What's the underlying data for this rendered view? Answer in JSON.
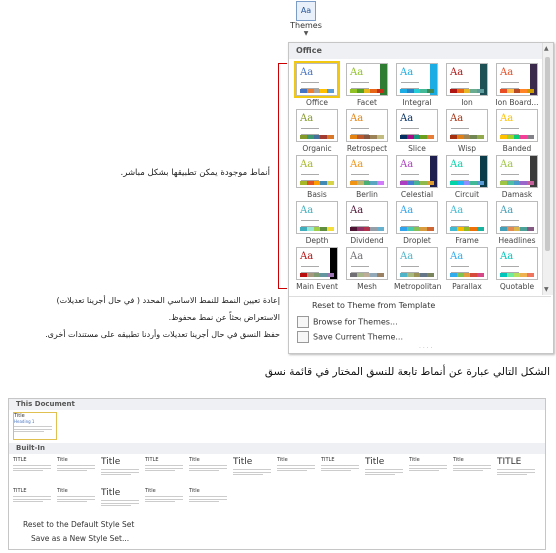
{
  "themes_button": {
    "label": "Themes",
    "icon": "Aa"
  },
  "gallery": {
    "section": "Office",
    "tiles": [
      {
        "label": "Office",
        "bars": [
          "#4472c4",
          "#ed7d31",
          "#a5a5a5",
          "#ffc000",
          "#5b9bd5"
        ],
        "side": "",
        "selected": true
      },
      {
        "label": "Facet",
        "bars": [
          "#90c226",
          "#54a021",
          "#e6b91e",
          "#e76618",
          "#c42f1a"
        ],
        "side": "#2e7d32",
        "selected": false
      },
      {
        "label": "Integral",
        "bars": [
          "#1cade4",
          "#2683c6",
          "#27ced7",
          "#42ba97",
          "#3e8853"
        ],
        "side": "#1cade4",
        "selected": false
      },
      {
        "label": "Ion",
        "bars": [
          "#b01513",
          "#ea6312",
          "#e6b729",
          "#6aac90",
          "#5f9c9d"
        ],
        "side": "#1e5155",
        "selected": false
      },
      {
        "label": "Ion Board...",
        "bars": [
          "#e84c22",
          "#ffbd47",
          "#b64926",
          "#ff8427",
          "#cc9900"
        ],
        "side": "#3c2a4d",
        "selected": false
      },
      {
        "label": "Organic",
        "bars": [
          "#83992a",
          "#3c9770",
          "#44709d",
          "#a23c33",
          "#d97828"
        ],
        "side": "",
        "selected": false
      },
      {
        "label": "Retrospect",
        "bars": [
          "#e48312",
          "#bd582c",
          "#865640",
          "#9b8357",
          "#c2bc80"
        ],
        "side": "",
        "selected": false
      },
      {
        "label": "Slice",
        "bars": [
          "#052f61",
          "#a50e82",
          "#14967c",
          "#6a9e1f",
          "#e87d37"
        ],
        "side": "",
        "selected": false
      },
      {
        "label": "Wisp",
        "bars": [
          "#a53010",
          "#de7e18",
          "#9f8351",
          "#728653",
          "#92aa4c"
        ],
        "side": "",
        "selected": false
      },
      {
        "label": "Banded",
        "bars": [
          "#ffc000",
          "#a5d028",
          "#08cc78",
          "#f24099",
          "#828288"
        ],
        "side": "",
        "selected": false
      },
      {
        "label": "Basis",
        "bars": [
          "#a6b727",
          "#df5327",
          "#fe9e00",
          "#418ab3",
          "#d7d447"
        ],
        "side": "",
        "selected": false
      },
      {
        "label": "Berlin",
        "bars": [
          "#f09415",
          "#c1b56b",
          "#4baf73",
          "#5aa6c0",
          "#d17df9"
        ],
        "side": "",
        "selected": false
      },
      {
        "label": "Celestial",
        "bars": [
          "#ac3ec1",
          "#477bd1",
          "#46b298",
          "#90ba4c",
          "#dd9d31"
        ],
        "side": "#1f1f4f",
        "selected": false
      },
      {
        "label": "Circuit",
        "bars": [
          "#03d4a8",
          "#21b4f2",
          "#8e8eff",
          "#42ba97",
          "#5b9bd5"
        ],
        "side": "#0b3c49",
        "selected": false
      },
      {
        "label": "Damask",
        "bars": [
          "#9ec544",
          "#50bea3",
          "#4a9ccc",
          "#9a66ca",
          "#c5609a"
        ],
        "side": "#3b3b3b",
        "selected": false
      },
      {
        "label": "Depth",
        "bars": [
          "#41aebd",
          "#97e9d5",
          "#a2cf49",
          "#608f3d",
          "#f4de3a"
        ],
        "side": "",
        "selected": false
      },
      {
        "label": "Dividend",
        "bars": [
          "#4d1434",
          "#903163",
          "#b2324b",
          "#969fa7",
          "#66b1ce"
        ],
        "side": "",
        "selected": false
      },
      {
        "label": "Droplet",
        "bars": [
          "#2fa3ee",
          "#4bcaad",
          "#86c157",
          "#d99c3f",
          "#ce6633"
        ],
        "side": "",
        "selected": false
      },
      {
        "label": "Frame",
        "bars": [
          "#40bad2",
          "#fab900",
          "#90bb23",
          "#ee7008",
          "#1ab39f"
        ],
        "side": "",
        "selected": false
      },
      {
        "label": "Headlines",
        "bars": [
          "#439eb7",
          "#e28b55",
          "#dcb64d",
          "#4ca198",
          "#835b82"
        ],
        "side": "",
        "selected": false
      },
      {
        "label": "Main Event",
        "bars": [
          "#b80e0f",
          "#a6987d",
          "#7f9a71",
          "#64969f",
          "#9b75b2"
        ],
        "side": "#000000",
        "selected": false
      },
      {
        "label": "Mesh",
        "bars": [
          "#6f6f74",
          "#a7b789",
          "#beae98",
          "#92a9b9",
          "#9c8265"
        ],
        "side": "",
        "selected": false
      },
      {
        "label": "Metropolitan",
        "bars": [
          "#50b4c8",
          "#a8b97f",
          "#9b9256",
          "#657689",
          "#7a855d"
        ],
        "side": "",
        "selected": false
      },
      {
        "label": "Parallax",
        "bars": [
          "#30acec",
          "#80c34f",
          "#e29d3e",
          "#d64a3b",
          "#d64787"
        ],
        "side": "",
        "selected": false
      },
      {
        "label": "Quotable",
        "bars": [
          "#00c6bb",
          "#6feba0",
          "#b6df5e",
          "#efb251",
          "#ef755f"
        ],
        "side": "",
        "selected": false
      }
    ],
    "menu": [
      {
        "label": "Reset to Theme from Template"
      },
      {
        "label": "Browse for Themes..."
      },
      {
        "label": "Save Current Theme..."
      }
    ]
  },
  "annotations": {
    "themes_note": "أنماط موجودة يمكن تطبيقها بشكل مباشر.",
    "reset_note": "إعادة تعيين النمط للنمط الاساسي المحدد ( في حال أجرينا تعديلات)",
    "browse_note": "الاستعراض بحثاً عن نمط محفوظ.",
    "save_note": "حفظ النسق في حال أجرينا تعديلات وأردنا تطبيقه على مستندات أخرى."
  },
  "caption": "الشكل التالي عبارة عن أنماط تابعة للنسق المختار في قائمة نسق",
  "style_sets": {
    "section_this": "This Document",
    "section_builtin": "Built-In",
    "this_doc_title": "Title",
    "row1": [
      "TITLE",
      "Title",
      "Title",
      "TITLE",
      "Title",
      "Title",
      "Title",
      "TITLE",
      "Title",
      "Title",
      "Title",
      "TITLE"
    ],
    "row2": [
      "TITLE",
      "Title",
      "Title",
      "Title",
      "Title"
    ],
    "menu": [
      "Reset to the Default Style Set",
      "Save as a New Style Set..."
    ]
  }
}
